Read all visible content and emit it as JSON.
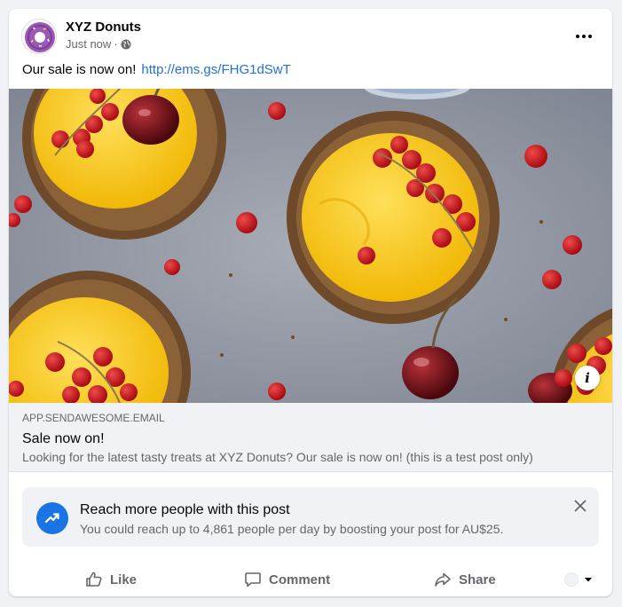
{
  "post": {
    "page_name": "XYZ Donuts",
    "timestamp": "Just now",
    "separator": "·",
    "privacy_icon": "globe-icon",
    "text": "Our sale is now on!",
    "link": "http://ems.gs/FHG1dSwT",
    "more_icon": "more-horizontal-icon"
  },
  "link_preview": {
    "domain": "APP.SENDAWESOME.EMAIL",
    "title": "Sale now on!",
    "description": "Looking for the latest tasty treats at XYZ Donuts? Our sale is now on! (this is a test post only)",
    "info_icon": "info-icon",
    "info_label": "i"
  },
  "boost": {
    "title": "Reach more people with this post",
    "description": "You could reach up to 4,861 people per day by boosting your post for AU$25.",
    "icon": "trending-up-icon",
    "close_icon": "close-icon"
  },
  "actions": {
    "like_label": "Like",
    "comment_label": "Comment",
    "share_label": "Share"
  },
  "colors": {
    "link": "#216fdb",
    "accent": "#1b74e4",
    "secondary_text": "#65676b",
    "background": "#f0f2f5"
  }
}
